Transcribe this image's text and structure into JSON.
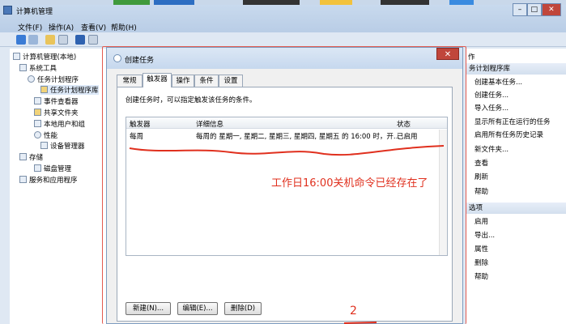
{
  "window": {
    "title": "计算机管理",
    "buttons": {
      "minimize": "–",
      "maximize": "□",
      "close": "✕"
    }
  },
  "menu": [
    "文件(F)",
    "操作(A)",
    "查看(V)",
    "帮助(H)"
  ],
  "tree": [
    {
      "label": "计算机管理(本地)",
      "level": 0
    },
    {
      "label": "系统工具",
      "level": 1
    },
    {
      "label": "任务计划程序",
      "level": 2
    },
    {
      "label": "任务计划程序库",
      "level": 3
    },
    {
      "label": "事件查看器",
      "level": 2
    },
    {
      "label": "共享文件夹",
      "level": 2
    },
    {
      "label": "本地用户和组",
      "level": 2
    },
    {
      "label": "性能",
      "level": 2
    },
    {
      "label": "设备管理器",
      "level": 2
    },
    {
      "label": "存储",
      "level": 1
    },
    {
      "label": "磁盘管理",
      "level": 2
    },
    {
      "label": "服务和应用程序",
      "level": 1
    }
  ],
  "actions": {
    "section1_header": "务计划程序库",
    "section1_items": [
      "创建基本任务...",
      "创建任务...",
      "导入任务...",
      "显示所有正在运行的任务",
      "启用所有任务历史记录",
      "新文件夹...",
      "查看",
      "刷新",
      "帮助"
    ],
    "section2_header": "选项",
    "section2_items": [
      "启用",
      "导出...",
      "属性",
      "删除",
      "帮助"
    ],
    "col_label": "作"
  },
  "dialog": {
    "title": "创建任务",
    "close": "✕",
    "tabs": [
      "常规",
      "触发器",
      "操作",
      "条件",
      "设置"
    ],
    "active_tab": "触发器",
    "description": "创建任务时，可以指定触发该任务的条件。",
    "table": {
      "headers": [
        "触发器",
        "详细信息",
        "状态"
      ],
      "rows": [
        [
          "每周",
          "每周的 星期一, 星期二, 星期三, 星期四, 星期五 的 16:00 时，开...",
          "已启用"
        ]
      ]
    },
    "buttons": {
      "new": "新建(N)...",
      "edit": "编辑(E)...",
      "delete": "删除(D)"
    }
  },
  "annotation": {
    "text": "工作日16:00关机命令已经存在了",
    "number": "2",
    "color": "#e0301e"
  }
}
